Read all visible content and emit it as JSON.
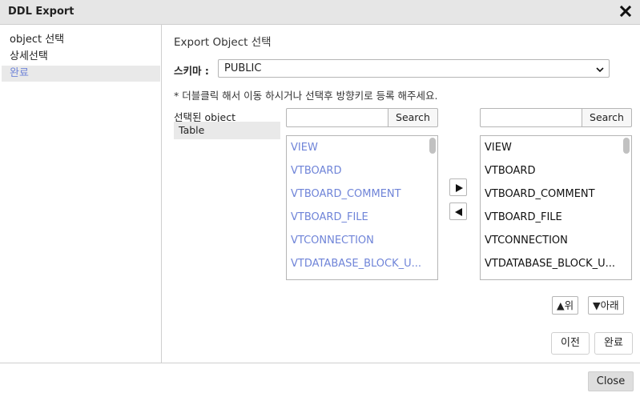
{
  "window": {
    "title": "DDL Export",
    "close_icon": "close-x-icon"
  },
  "sidebar": {
    "items": [
      {
        "label": "object 선택",
        "active": false
      },
      {
        "label": "상세선택",
        "active": false
      },
      {
        "label": "완료",
        "active": true
      }
    ]
  },
  "main": {
    "section_title": "Export Object 선택",
    "schema": {
      "label": "스키마 :",
      "value": "PUBLIC"
    },
    "hint": "* 더블클릭 해서 이동 하시거나 선택후 방향키로 등록 해주세요.",
    "selected_object": {
      "label": "선택된 object",
      "items": [
        "Table"
      ]
    },
    "left_list": {
      "search_value": "",
      "search_label": "Search",
      "items": [
        "VIEW",
        "VTBOARD",
        "VTBOARD_COMMENT",
        "VTBOARD_FILE",
        "VTCONNECTION",
        "VTDATABASE_BLOCK_U..."
      ]
    },
    "right_list": {
      "search_value": "",
      "search_label": "Search",
      "items": [
        "VIEW",
        "VTBOARD",
        "VTBOARD_COMMENT",
        "VTBOARD_FILE",
        "VTCONNECTION",
        "VTDATABASE_BLOCK_U..."
      ]
    },
    "move_right_icon": "arrow-right-icon",
    "move_left_icon": "arrow-left-icon",
    "up_label": "▲위",
    "down_label": "▼아래",
    "prev_label": "이전",
    "finish_label": "완료"
  },
  "footer": {
    "close_label": "Close"
  },
  "colors": {
    "accent": "#6f84d8",
    "titlebar_bg": "#e6e6e6",
    "active_bg": "#e9e9e9"
  }
}
